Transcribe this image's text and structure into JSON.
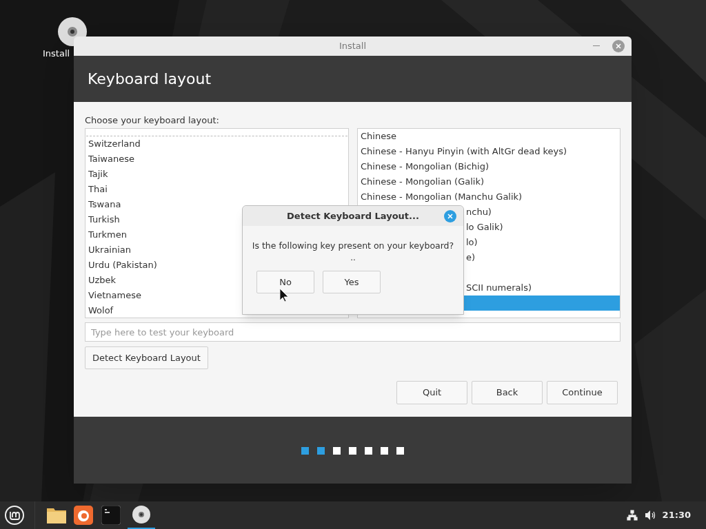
{
  "desktop": {
    "icons": [
      {
        "label": "Install"
      }
    ]
  },
  "window": {
    "title": "Install",
    "header": "Keyboard layout",
    "prompt": "Choose your keyboard layout:",
    "layouts": [
      {
        "label": "Switzerland",
        "selected": false
      },
      {
        "label": "Taiwanese",
        "selected": false
      },
      {
        "label": "Tajik",
        "selected": false
      },
      {
        "label": "Thai",
        "selected": false
      },
      {
        "label": "Tswana",
        "selected": false
      },
      {
        "label": "Turkish",
        "selected": false
      },
      {
        "label": "Turkmen",
        "selected": false
      },
      {
        "label": "Ukrainian",
        "selected": false
      },
      {
        "label": "Urdu (Pakistan)",
        "selected": false
      },
      {
        "label": "Uzbek",
        "selected": false
      },
      {
        "label": "Vietnamese",
        "selected": false
      },
      {
        "label": "Wolof",
        "selected": false
      }
    ],
    "variants": [
      {
        "label": "Chinese",
        "selected": false,
        "covered": false
      },
      {
        "label": "Chinese - Hanyu Pinyin (with AltGr dead keys)",
        "selected": false,
        "covered": false
      },
      {
        "label": "Chinese - Mongolian (Bichig)",
        "selected": false,
        "covered": false
      },
      {
        "label": "Chinese - Mongolian (Galik)",
        "selected": false,
        "covered": false
      },
      {
        "label": "Chinese - Mongolian (Manchu Galik)",
        "selected": false,
        "covered": false
      },
      {
        "label": "nchu)",
        "selected": false,
        "covered": true
      },
      {
        "label": "lo Galik)",
        "selected": false,
        "covered": true
      },
      {
        "label": "lo)",
        "selected": false,
        "covered": true
      },
      {
        "label": "e)",
        "selected": false,
        "covered": true
      },
      {
        "selected": false
      },
      {
        "label": "SCII numerals)",
        "selected": false,
        "covered": true
      },
      {
        "selected": true
      }
    ],
    "test_field": {
      "placeholder": "Type here to test your keyboard"
    },
    "detect_button": "Detect Keyboard Layout",
    "buttons": [
      "Quit",
      "Back",
      "Continue"
    ],
    "steps": [
      {
        "done": true
      },
      {
        "done": true
      },
      {
        "done": false
      },
      {
        "done": false
      },
      {
        "done": false
      },
      {
        "done": false
      },
      {
        "done": false
      }
    ]
  },
  "dialog": {
    "title": "Detect Keyboard Layout...",
    "question": "Is the following key present on your keyboard?",
    "key": "..",
    "buttons": [
      "No",
      "Yes"
    ]
  },
  "taskbar": {
    "clock": "21:30"
  }
}
